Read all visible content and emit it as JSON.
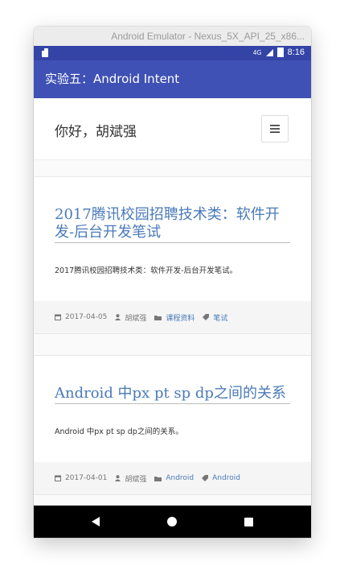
{
  "emulator": {
    "window_title": "Android Emulator - Nexus_5X_API_25_x86..."
  },
  "status_bar": {
    "network": "4G",
    "time": "8:16"
  },
  "app_bar": {
    "title": "实验五：Android Intent"
  },
  "site": {
    "title": "你好，胡斌强"
  },
  "posts": [
    {
      "title": "2017腾讯校园招聘技术类：软件开发-后台开发笔试",
      "excerpt": "2017腾讯校园招聘技术类：软件开发-后台开发笔试。",
      "date": "2017-04-05",
      "author": "胡斌强",
      "category": "课程资料",
      "tag": "笔试"
    },
    {
      "title": "Android 中px pt sp dp之间的关系",
      "excerpt": "Android 中px pt sp dp之间的关系。",
      "date": "2017-04-01",
      "author": "胡斌强",
      "category": "Android",
      "tag": "Android"
    }
  ],
  "colors": {
    "status_bar": "#3344a6",
    "app_bar": "#3f51b5",
    "link": "#4a7ab8"
  },
  "icons": {
    "menu": "hamburger-icon",
    "date": "calendar-icon",
    "author": "person-icon",
    "category": "folder-icon",
    "tag": "tag-icon",
    "nav_back": "back-triangle-icon",
    "nav_home": "home-circle-icon",
    "nav_recent": "recents-square-icon"
  }
}
